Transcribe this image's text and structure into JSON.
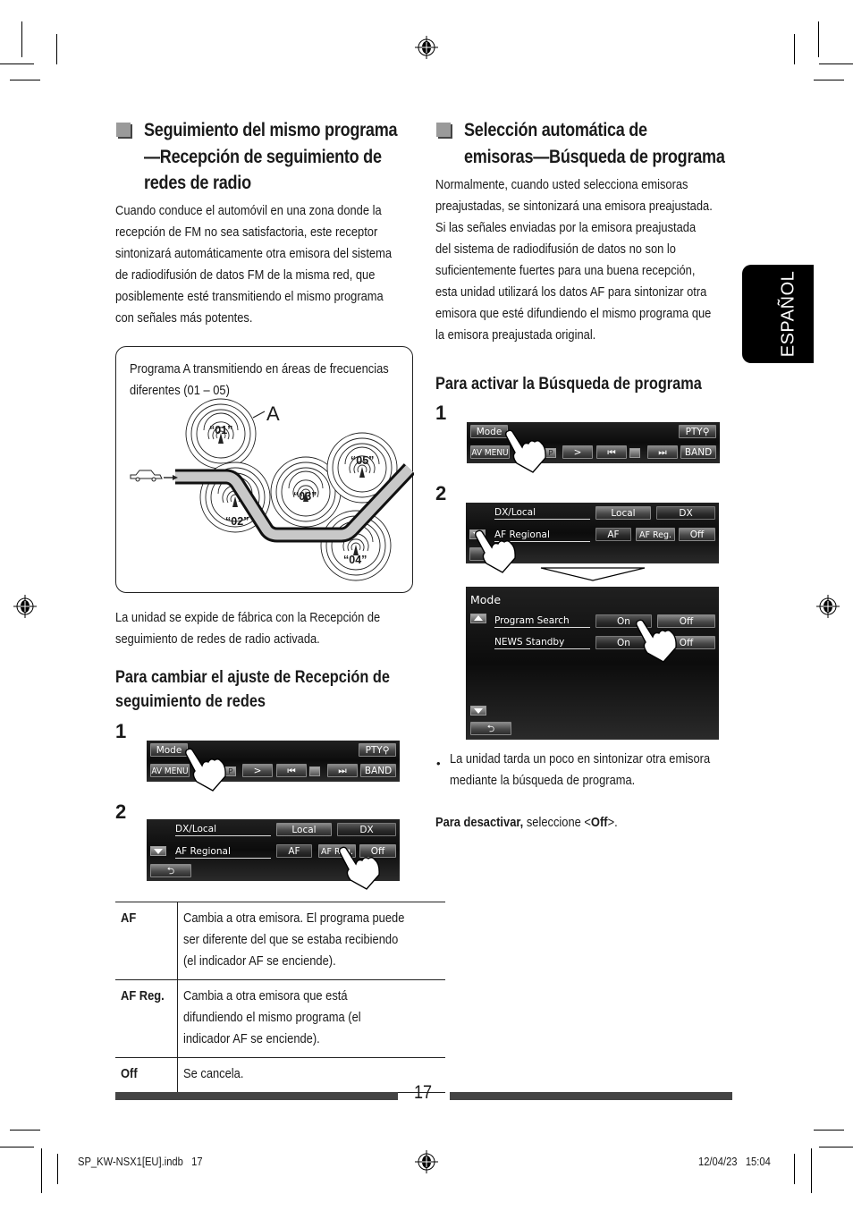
{
  "language_tab": "ESPAÑOL",
  "left_section": {
    "title_lines": [
      "Seguimiento del mismo programa",
      "—Recepción de seguimiento de",
      "redes de radio"
    ],
    "intro_lines": [
      "Cuando conduce el automóvil en una zona donde la",
      "recepción de FM no sea satisfactoria, este receptor",
      "sintonizará automáticamente otra emisora del sistema",
      "de radiodifusión de datos FM de la misma red, que",
      "posiblemente esté transmitiendo el mismo programa",
      "con señales más potentes."
    ],
    "diagram": {
      "caption_lines": [
        "Programa A transmitiendo en áreas de frecuencias",
        "diferentes (01 – 05)"
      ],
      "program_label": "A",
      "stations": [
        "“01”",
        "“02”",
        "“03”",
        "“04”",
        "“05”"
      ],
      "icons": {
        "vehicle": "car-icon",
        "antenna": "antenna-icon"
      }
    },
    "factory_note_lines": [
      "La unidad se expide de fábrica con la Recepción de",
      "seguimiento de redes de radio activada."
    ],
    "subhead_lines": [
      "Para cambiar el ajuste de Recepción de ",
      "seguimiento de redes"
    ],
    "steps": [
      "1",
      "2"
    ],
    "table": [
      {
        "key": "AF",
        "desc_lines": [
          "Cambia a otra emisora. El programa puede",
          "ser diferente del que se estaba recibiendo",
          "(el indicador AF se enciende)."
        ]
      },
      {
        "key": "AF Reg.",
        "desc_lines": [
          "Cambia a otra emisora que está",
          "difundiendo el mismo programa (el",
          "indicador AF se enciende)."
        ]
      },
      {
        "key": "Off",
        "desc_lines": [
          "Se cancela."
        ]
      }
    ]
  },
  "right_section": {
    "title_lines": [
      "Selección automática de",
      "emisoras—Búsqueda de programa"
    ],
    "intro_lines": [
      "Normalmente, cuando usted selecciona emisoras",
      "preajustadas, se sintonizará una emisora preajustada.",
      "Si las señales enviadas por la emisora preajustada",
      "del sistema de radiodifusión de datos no son lo",
      "suficientemente fuertes para una buena recepción,",
      "esta unidad utilizará los datos AF para sintonizar otra",
      "emisora que esté difundiendo el mismo programa que",
      "la emisora preajustada original."
    ],
    "subhead": "Para activar la Búsqueda de programa",
    "steps": [
      "1",
      "2"
    ],
    "note_lines": [
      "La unidad tarda un poco en sintonizar otra emisora",
      "mediante la búsqueda de programa."
    ],
    "deactivate": {
      "bold": "Para desactivar,",
      "text": " seleccione <",
      "option": "Off",
      "end": ">."
    }
  },
  "screens": {
    "source_bar": {
      "mode": "Mode",
      "pty": "PTY",
      "av_menu": "AV MENU",
      "p": "P",
      "next": ">",
      "prev_track": "⏮",
      "next_track": "⏭",
      "band": "BAND"
    },
    "settings": {
      "dx_local_label": "DX/Local",
      "local": "Local",
      "dx": "DX",
      "af_regional_label": "AF Regional",
      "af": "AF",
      "af_reg": "AF Reg.",
      "off": "Off",
      "back": "⮌"
    },
    "mode_menu": {
      "title": "Mode",
      "rows": [
        {
          "label": "Program Search",
          "on": "On",
          "off": "Off"
        },
        {
          "label": "NEWS Standby",
          "on": "On",
          "off": "Off"
        }
      ],
      "back": "⮌"
    }
  },
  "page": {
    "number": "17",
    "footer_file": "SP_KW-NSX1[EU].indb   17",
    "footer_date": "12/04/23   15:04"
  }
}
